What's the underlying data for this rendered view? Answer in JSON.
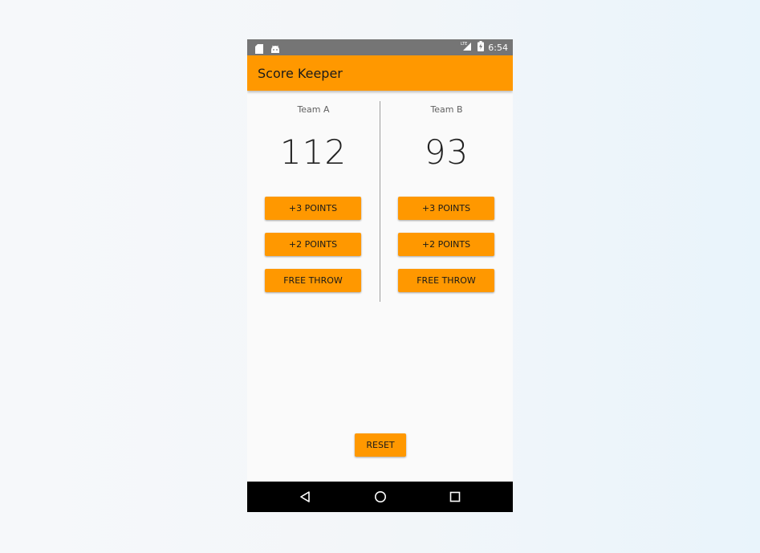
{
  "status_bar": {
    "time": "6:54",
    "left_icons": [
      "sd-card-icon",
      "android-icon"
    ],
    "right_icons": [
      "lte-signal-icon",
      "battery-charging-icon"
    ],
    "network_label": "LTE"
  },
  "app_bar": {
    "title": "Score Keeper"
  },
  "team_a": {
    "name": "Team A",
    "score": "112",
    "buttons": {
      "plus3": "+3 POINTS",
      "plus2": "+2 POINTS",
      "free_throw": "FREE THROW"
    }
  },
  "team_b": {
    "name": "Team B",
    "score": "93",
    "buttons": {
      "plus3": "+3 POINTS",
      "plus2": "+2 POINTS",
      "free_throw": "FREE THROW"
    }
  },
  "reset_label": "RESET",
  "nav_bar": {
    "icons": [
      "back-icon",
      "home-icon",
      "recent-apps-icon"
    ]
  },
  "colors": {
    "accent": "#ff9800",
    "status_bar": "#757575",
    "background": "#fafafa",
    "nav_bar": "#000000"
  }
}
